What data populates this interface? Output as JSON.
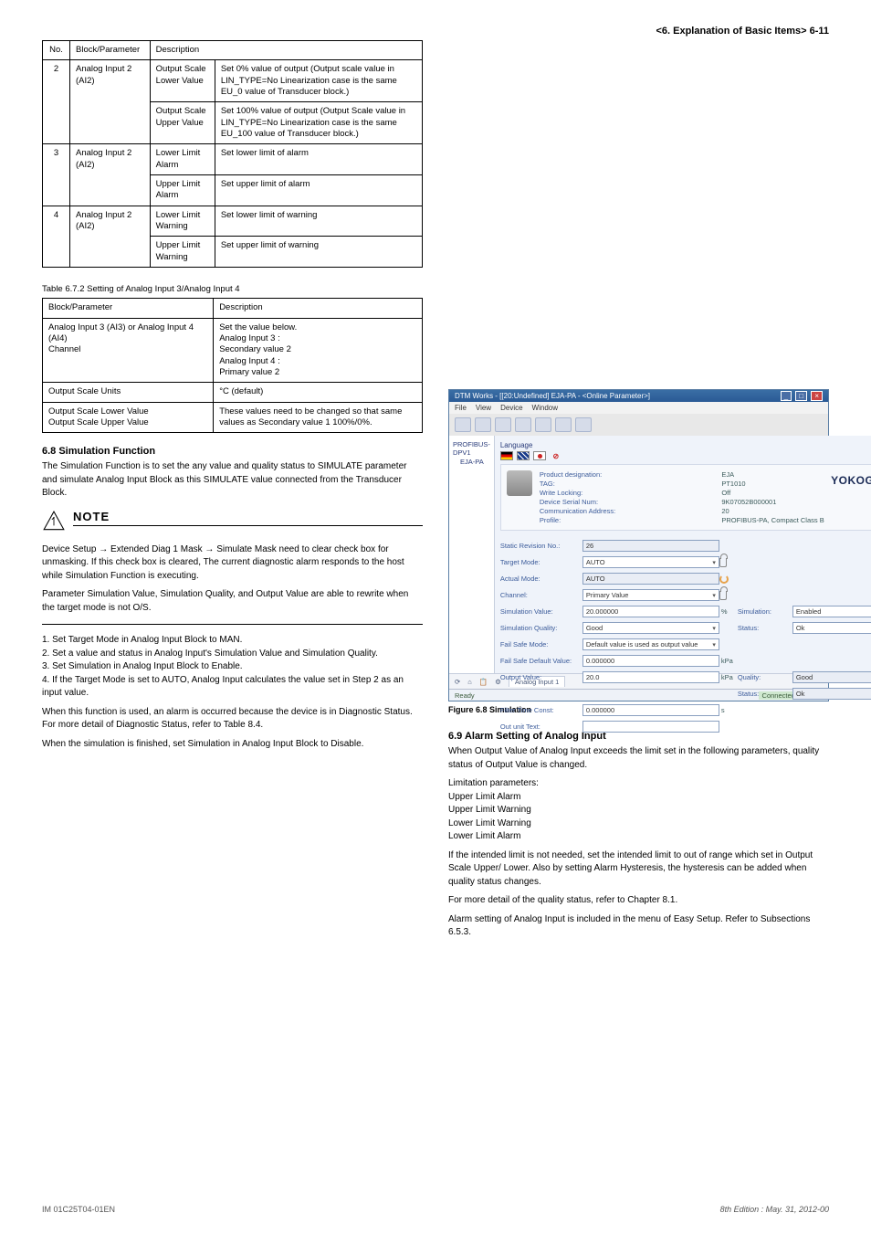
{
  "header_right": "<6. Explanation of Basic Items>     6-11",
  "table1": {
    "headers": [
      "No.",
      "Block/Parameter",
      "Description"
    ],
    "rows": [
      {
        "no": "2",
        "block": "Analog Input 2 (AI2)",
        "items": [
          {
            "param": "Output Scale Lower Value",
            "desc": "Set 0% value of output (Output scale value in LIN_TYPE=No Linearization case is the same EU_0 value of Transducer block.)"
          },
          {
            "param": "Output Scale Upper Value",
            "desc": "Set 100% value of output (Output Scale value in LIN_TYPE=No Linearization case is the same EU_100 value of Transducer block.)"
          }
        ]
      },
      {
        "no": "3",
        "block": "Analog Input 2 (AI2)",
        "items": [
          {
            "param": "Lower Limit Alarm",
            "desc": "Set lower limit of alarm"
          },
          {
            "param": "Upper Limit Alarm",
            "desc": "Set upper limit of alarm"
          }
        ]
      },
      {
        "no": "4",
        "block": "Analog Input 2 (AI2)",
        "items": [
          {
            "param": "Lower Limit Warning",
            "desc": "Set lower limit of warning"
          },
          {
            "param": "Upper Limit Warning",
            "desc": "Set upper limit of warning"
          }
        ]
      }
    ]
  },
  "table2": {
    "title": "Table 6.7.2 Setting of Analog Input 3/Analog Input 4",
    "headers": [
      "Block/Parameter",
      "Description"
    ],
    "rows": [
      {
        "block": "Analog Input 3 (AI3) or Analog Input 4 (AI4)\nChannel",
        "desc": "Set the value below.\nAnalog Input 3 :\n  Secondary value 2\nAnalog Input 4 :\n  Primary value 2"
      },
      {
        "block": "Output Scale Units",
        "desc": "°C (default)"
      },
      {
        "block": "Output Scale Lower Value\nOutput Scale Upper Value",
        "desc": "These values need to be changed so that same values as Secondary value 1 100%/0%."
      }
    ]
  },
  "section_6_8": {
    "title": "6.8     Simulation Function",
    "p1": "The Simulation Function is to set the any value and quality status to SIMULATE parameter and simulate Analog Input Block as this SIMULATE value connected from the Transducer Block.",
    "note_title": "NOTE",
    "note_p1": "Device Setup → Extended Diag 1 Mask → Simulate Mask need to clear check box for unmasking. If this check box is cleared, The current diagnostic alarm responds to the host while Simulation Function is executing.",
    "note_p2": "Parameter Simulation Value, Simulation Quality, and Output Value are able to rewrite when the target mode is not O/S.",
    "p2": "1. Set Target Mode in Analog Input Block to MAN.\n2. Set a value and status in Analog Input's Simulation Value and Simulation Quality.\n3. Set Simulation in Analog Input Block to Enable.\n4. If the Target Mode is set to AUTO, Analog Input calculates the value set in Step 2 as an input value.",
    "p3": "When this function is used, an alarm is occurred because the device is in Diagnostic Status. For more detail of Diagnostic Status, refer to Table 8.4.",
    "p4": "When the simulation is finished, set Simulation in Analog Input Block to Disable."
  },
  "screenshot": {
    "title": "DTM Works - [[20:Undefined] EJA-PA - <Online Parameter>]",
    "menus": [
      "File",
      "View",
      "Device",
      "Window"
    ],
    "tree": [
      "PROFIBUS-DPV1",
      "EJA-PA"
    ],
    "lang_label": "Language",
    "hdr": {
      "k1": "Product designation:",
      "v1": "EJA",
      "k2": "TAG:",
      "v2": "PT1010",
      "k3": "Write Locking:",
      "v3": "Off",
      "k4": "Device Serial Num:",
      "v4": "9K07052B000001",
      "k5": "Communication Address:",
      "v5": "20",
      "k6": "Profile:",
      "v6": "PROFIBUS-PA, Compact Class B"
    },
    "logo": "YOKOGAWA",
    "form": {
      "static_rev": {
        "lbl": "Static Revision No.:",
        "val": "26"
      },
      "target_mode": {
        "lbl": "Target Mode:",
        "val": "AUTO"
      },
      "actual_mode": {
        "lbl": "Actual Mode:",
        "val": "AUTO"
      },
      "channel": {
        "lbl": "Channel:",
        "val": "Primary Value"
      },
      "sim_value": {
        "lbl": "Simulation Value:",
        "val": "20.000000",
        "unit": "%"
      },
      "enabled": {
        "lbl": "Simulation:",
        "val": "Enabled"
      },
      "sim_quality": {
        "lbl": "Simulation Quality:",
        "val": "Good"
      },
      "status": {
        "lbl": "Status:",
        "val": "Ok"
      },
      "fail_safe_mode": {
        "lbl": "Fail Safe Mode:",
        "val": "Default value is used as output value"
      },
      "fail_safe_def": {
        "lbl": "Fail Safe Default Value:",
        "val": "0.000000",
        "unit": "kPa"
      },
      "output_value": {
        "lbl": "Output Value:",
        "val": "20.0",
        "unit": "kPa"
      },
      "quality": {
        "lbl": "Quality:",
        "val": "Good"
      },
      "status2": {
        "lbl": "Status:",
        "val": "Ok"
      },
      "filter_time": {
        "lbl": "Filter Time Const:",
        "val": "0.000000",
        "unit": "s"
      },
      "out_unit": {
        "lbl": "Out unit Text:",
        "val": ""
      }
    },
    "tabs": [
      "⟳",
      "⌂",
      "📋",
      "⚙",
      "Analog Input 1"
    ],
    "status_bar": {
      "conn": "Connected",
      "ready": "Ready"
    },
    "caption": "Figure 6.8   Simulation"
  },
  "section_6_9": {
    "title": "6.9     Alarm Setting of Analog Input",
    "p1": "When Output Value of Analog Input exceeds the limit set in the following parameters, quality status of Output Value is changed.",
    "p2": "Limitation parameters:\n   Upper Limit Alarm\n   Upper Limit Warning\n   Lower Limit Warning\n   Lower Limit Alarm",
    "p3": "If the intended limit is not needed, set the intended limit to out of range which set in Output Scale Upper/ Lower. Also by setting Alarm Hysteresis, the hysteresis can be added when quality status changes.",
    "p4": "For more detail of the quality status, refer to Chapter 8.1.",
    "p5": "Alarm setting of Analog Input is included in the menu of Easy Setup. Refer to Subsections 6.5.3."
  },
  "footer": {
    "left": "IM 01C25T04-01EN",
    "right": "8th Edition : May. 31, 2012-00"
  }
}
